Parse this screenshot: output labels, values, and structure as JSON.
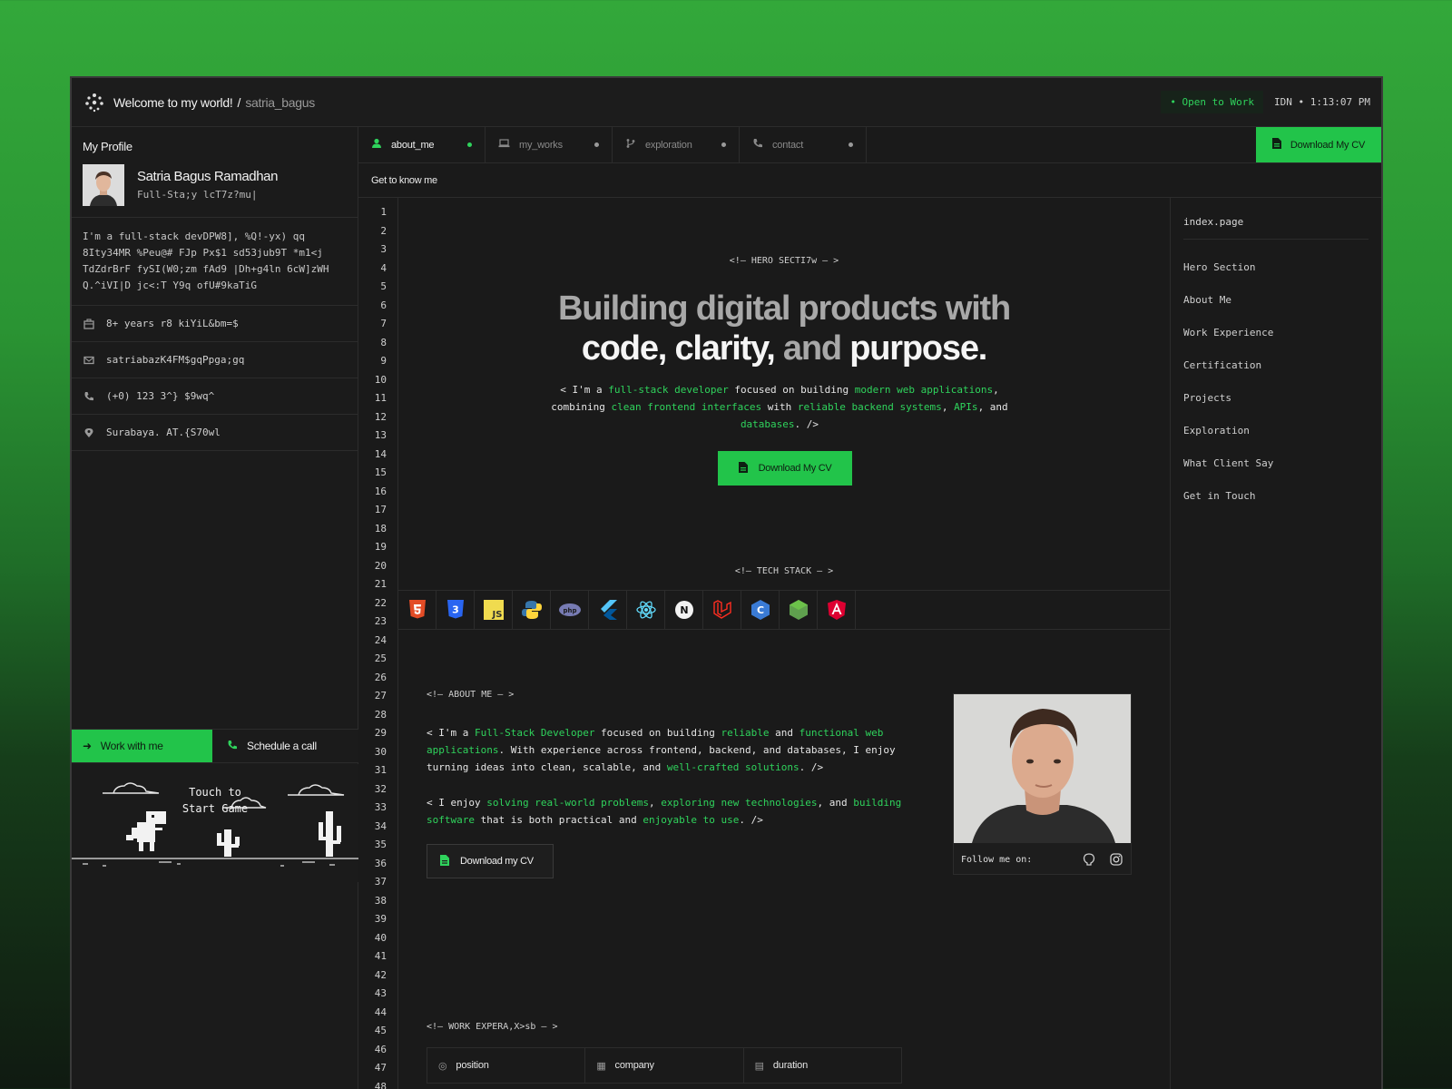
{
  "header": {
    "title": "Welcome to my world!",
    "separator": "/",
    "username": "satria_bagus",
    "status": "• Open to Work",
    "clock": "IDN • 1:13:07 PM"
  },
  "sidebar": {
    "title": "My Profile",
    "name": "Satria Bagus Ramadhan",
    "role": "Full-Sta;y lcT7z?mu|",
    "bio": [
      "I'm a full-stack devDPW8], %Q!-yx) qq",
      "8Ity34MR %Peu@# FJp Px$1 sd53jub9T *m1<j",
      "TdZdrBrF fySI(W0;zm fAd9 |Dh+g4ln 6cW]zWH",
      "Q.^iVI|D jc<:T Y9q ofU#9kaTiG"
    ],
    "info": [
      {
        "icon": "briefcase-icon",
        "text": "8+ years r8 kiYiL&bm=$"
      },
      {
        "icon": "mail-icon",
        "text": "satriabazK4FM$gqPpga;gq"
      },
      {
        "icon": "phone-icon",
        "text": "(+0) 123 3^} $9wq^"
      },
      {
        "icon": "location-icon",
        "text": "Surabaya. AT.{S70wl"
      }
    ],
    "work_button": "Work with me",
    "call_button": "Schedule a call",
    "game_line1": "Touch to",
    "game_line2": "Start Game"
  },
  "tabs": [
    {
      "label": "about_me",
      "icon": "user-icon",
      "active": true
    },
    {
      "label": "my_works",
      "icon": "laptop-icon",
      "active": false
    },
    {
      "label": "exploration",
      "icon": "branch-icon",
      "active": false
    },
    {
      "label": "contact",
      "icon": "phone-icon",
      "active": false
    }
  ],
  "download_top": "Download My CV",
  "subtitle": "Get to know me",
  "hero": {
    "comment": "<!— HERO SECTI7w — >",
    "title_l1": "Building digital products with",
    "title_l2_a": "code, clarity,",
    "title_l2_b": "and",
    "title_l2_c": "purpose.",
    "desc": [
      {
        "t": "< I'm a ",
        "g": false
      },
      {
        "t": "full-stack developer",
        "g": true
      },
      {
        "t": " focused on building ",
        "g": false
      },
      {
        "t": "modern web applications",
        "g": true
      },
      {
        "t": ", combining ",
        "g": false
      },
      {
        "t": "clean frontend interfaces",
        "g": true
      },
      {
        "t": " with ",
        "g": false
      },
      {
        "t": "reliable backend systems",
        "g": true
      },
      {
        "t": ", ",
        "g": false
      },
      {
        "t": "APIs",
        "g": true
      },
      {
        "t": ", and ",
        "g": false
      },
      {
        "t": "databases",
        "g": true
      },
      {
        "t": ". />",
        "g": false
      }
    ],
    "button": "Download My CV"
  },
  "tech": {
    "comment": "<!— TECH STACK — >",
    "icons": [
      "html5-icon",
      "css3-icon",
      "javascript-icon",
      "python-icon",
      "php-icon",
      "flutter-icon",
      "react-icon",
      "nextjs-icon",
      "laravel-icon",
      "c-icon",
      "nodejs-icon",
      "angular-icon"
    ]
  },
  "about": {
    "comment": "<!— ABOUT ME — >",
    "p1": [
      {
        "t": "< I'm a ",
        "g": false
      },
      {
        "t": "Full-Stack Developer",
        "g": true
      },
      {
        "t": " focused on building ",
        "g": false
      },
      {
        "t": "reliable",
        "g": true
      },
      {
        "t": " and ",
        "g": false
      },
      {
        "t": "functional web applications",
        "g": true
      },
      {
        "t": ". With experience across frontend, backend, and databases, I enjoy turning ideas into clean, scalable, and ",
        "g": false
      },
      {
        "t": "well-crafted solutions",
        "g": true
      },
      {
        "t": ". />",
        "g": false
      }
    ],
    "p2": [
      {
        "t": "< I enjoy ",
        "g": false
      },
      {
        "t": "solving real-world problems",
        "g": true
      },
      {
        "t": ", ",
        "g": false
      },
      {
        "t": "exploring new technologies",
        "g": true
      },
      {
        "t": ", and ",
        "g": false
      },
      {
        "t": "building software",
        "g": true
      },
      {
        "t": " that is both practical and ",
        "g": false
      },
      {
        "t": "enjoyable to use",
        "g": true
      },
      {
        "t": ". />",
        "g": false
      }
    ],
    "button": "Download my CV",
    "follow": "Follow me on:"
  },
  "work": {
    "comment": "<!— WORK EXPERA,X>sb — >",
    "columns": [
      "position",
      "company",
      "duration"
    ]
  },
  "toc": {
    "head": "index.page",
    "items": [
      "Hero Section",
      "About Me",
      "Work Experience",
      "Certification",
      "Projects",
      "Exploration",
      "What Client Say",
      "Get in Touch"
    ]
  },
  "line_numbers": [
    "1",
    "2",
    "3",
    "4",
    "5",
    "6",
    "7",
    "8",
    "9",
    "10",
    "11",
    "12",
    "13",
    "14",
    "15",
    "16",
    "17",
    "18",
    "19",
    "20",
    "21",
    "22",
    "23",
    "24",
    "25",
    "26",
    "27",
    "28",
    "29",
    "30",
    "31",
    "32",
    "33",
    "34",
    "35",
    "36",
    "37",
    "38",
    "39",
    "40",
    "41",
    "42",
    "43",
    "44",
    "45",
    "46",
    "47",
    "48"
  ],
  "colors": {
    "accent": "#22c44a",
    "accent_text": "#2fd35c",
    "bg": "#1a1a1a"
  }
}
